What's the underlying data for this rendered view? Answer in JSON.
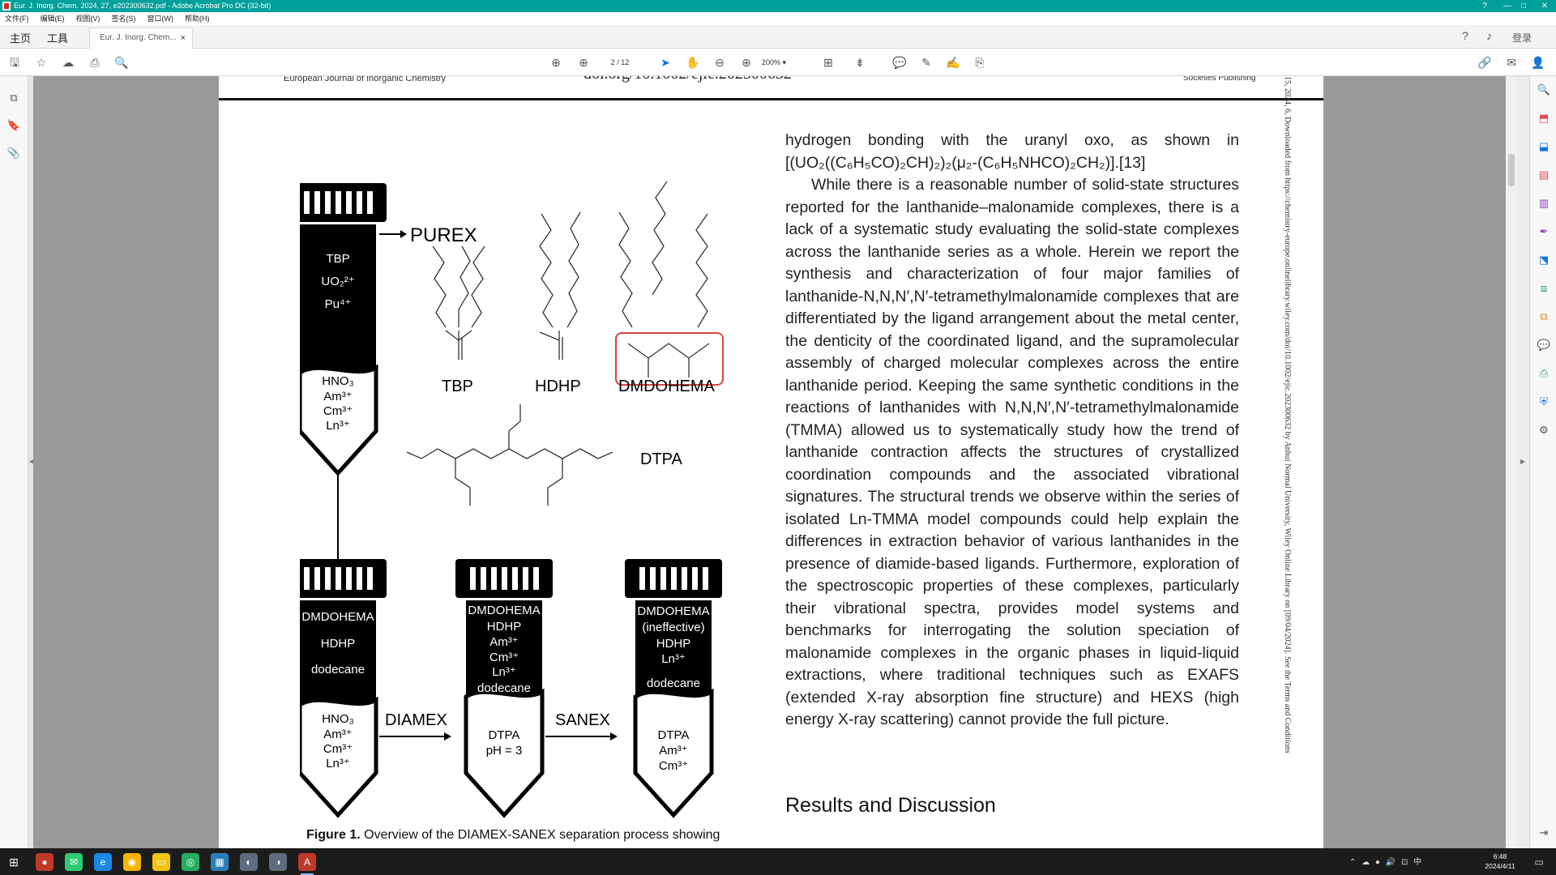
{
  "window": {
    "title": "Eur. J. Inorg. Chem. 2024, 27, e202300632.pdf - Adobe Acrobat Pro DC (32-bit)",
    "controls": [
      "?",
      "—",
      "□",
      "✕"
    ]
  },
  "menu": [
    "文件(F)",
    "编辑(E)",
    "视图(V)",
    "签名(S)",
    "窗口(W)",
    "帮助(H)"
  ],
  "tabs": {
    "home": "主页",
    "tools": "工具",
    "document": "Eur. J. Inorg. Chem...",
    "close": "×",
    "right_label": "登录"
  },
  "toolbar": {
    "page_current": "2",
    "page_total": "/ 12",
    "zoom": "200%"
  },
  "document": {
    "journal": "European Journal of Inorganic Chemistry",
    "doi": "doi.org/10.1002/ejic.202300632",
    "publisher": "Societies Publishing",
    "side_note": "15, 2024, 6, Downloaded from https://chemistry-europe.onlinelibrary.wiley.com/doi/10.1002/ejic.202300632 by Anhui Normal University, Wiley Online Library on [09/04/2024]. See the Terms and Conditions",
    "para1": "hydrogen bonding with the uranyl oxo, as shown in [(UO₂((C₆H₅CO)₂CH)₂)₂(μ₂-(C₆H₅NHCO)₂CH₂)].[13]",
    "para2": "While there is a reasonable number of solid-state structures reported for the lanthanide–malonamide complexes, there is a lack of a systematic study evaluating the solid-state complexes across the lanthanide series as a whole. Herein we report the synthesis and characterization of four major families of lanthanide-N,N,N′,N′-tetramethylmalonamide complexes that are differentiated by the ligand arrangement about the metal center, the denticity of the coordinated ligand, and the supramolecular assembly of charged molecular complexes across the entire lanthanide period. Keeping the same synthetic conditions in the reactions of lanthanides with N,N,N′,N′-tetramethylmalonamide (TMMA) allowed us to systematically study how the trend of lanthanide contraction affects the structures of crystallized coordination compounds and the associated vibrational signatures. The structural trends we observe within the series of isolated Ln-TMMA model compounds could help explain the differences in extraction behavior of various lanthanides in the presence of diamide-based ligands. Furthermore, exploration of the spectroscopic properties of these complexes, particularly their vibrational spectra, provides model systems and benchmarks for interrogating the solution speciation of malonamide complexes in the organic phases in liquid-liquid extractions, where traditional techniques such as EXAFS (extended X-ray absorption fine structure) and HEXS (high energy X-ray scattering) cannot provide the full picture.",
    "section_heading": "Results and Discussion",
    "caption_label": "Figure 1.",
    "caption_text": " Overview of the DIAMEX-SANEX separation process showing"
  },
  "figure": {
    "tube1_top": [
      "TBP",
      "UO₂²⁺",
      "Pu⁴⁺"
    ],
    "tube1_bottom": [
      "HNO₃",
      "Am³⁺",
      "Cm³⁺",
      "Ln³⁺"
    ],
    "purex": "PUREX",
    "ligand_tbp": "TBP",
    "ligand_hdhp": "HDHP",
    "ligand_dmdohema": "DMDOHEMA",
    "ligand_dtpa": "DTPA",
    "tube2_top": [
      "DMDOHEMA",
      "HDHP",
      "dodecane"
    ],
    "tube2_bottom": [
      "HNO₃",
      "Am³⁺",
      "Cm³⁺",
      "Ln³⁺"
    ],
    "diamex": "DIAMEX",
    "tube3_top": [
      "DMDOHEMA",
      "HDHP",
      "Am³⁺",
      "Cm³⁺",
      "Ln³⁺",
      "dodecane"
    ],
    "tube3_bottom": [
      "DTPA",
      "pH = 3"
    ],
    "sanex": "SANEX",
    "tube4_top": [
      "DMDOHEMA",
      "(ineffective)",
      "HDHP",
      "Ln³⁺",
      "dodecane"
    ],
    "tube4_bottom": [
      "DTPA",
      "Am³⁺",
      "Cm³⁺"
    ]
  },
  "taskbar": {
    "time": "6:48",
    "date": "2024/4/11",
    "tray": "⌃ ☁ ● 🔊 ⊡ 中"
  }
}
